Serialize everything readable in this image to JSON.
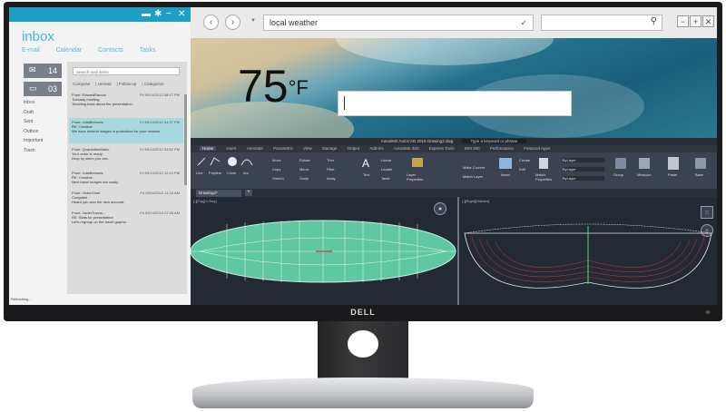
{
  "mail": {
    "title": "inbox",
    "nav": [
      "E-mail",
      "Calendar",
      "Contacts",
      "Tasks"
    ],
    "tiles": [
      {
        "icon": "envelope-icon",
        "count": "14"
      },
      {
        "icon": "chat-icon",
        "count": "03"
      }
    ],
    "folders": [
      "Inbox",
      "Draft",
      "Sent",
      "Outbox",
      "Important",
      "Trash"
    ],
    "search_placeholder": "Search mail items",
    "filters": [
      "Compose",
      "Unread",
      "Follow-up",
      "Categorize"
    ],
    "messages": [
      {
        "from": "From: EdwardRamos",
        "date": "Fri 09/14/2012 08:17 PM",
        "line1": "Tuesday meeting",
        "line2": "Touching base about the presentation.",
        "selected": false
      },
      {
        "from": "From: JuliaBehrans",
        "date": "Fri 09/14/2012 04:37 PM",
        "line1": "RE: Creative",
        "line2": "We have several images in production for your reviews.",
        "selected": true
      },
      {
        "from": "From: QuarantineMario",
        "date": "Fri 09/14/2012 03:52 PM",
        "line1": "Your order is ready.",
        "line2": "Drop by when you can.",
        "selected": false
      },
      {
        "from": "From: JuliaBehrans",
        "date": "Fri 09/14/2012 12:13 PM",
        "line1": "RE: Creative.",
        "line2": "Next travel images are ready.",
        "selected": false
      },
      {
        "from": "From: VictorChen",
        "date": "Fri 09/14/2012 11:16 AM",
        "line1": "Congrats!",
        "line2": "Heard you won the new account.",
        "selected": false
      },
      {
        "from": "From: JavierTruma...",
        "date": "Fri 09/14/2012 07:28 AM",
        "line1": "RE: Stats for presentation",
        "line2": "Let's regroup on the travel graphs.",
        "selected": false
      }
    ],
    "status": "Refreshing..."
  },
  "browser": {
    "address": "local weather",
    "temperature": "75",
    "unit": "°F"
  },
  "cad": {
    "title": "Autodesk AutoCAD 2015   Drawing2.dwg",
    "search_hint": "Type a keyword or phrase",
    "tabs": [
      "Home",
      "Insert",
      "Annotate",
      "Parametric",
      "View",
      "Manage",
      "Output",
      "Add-ins",
      "Autodesk 360",
      "Express Tools",
      "BIM 360",
      "Performance",
      "Featured Apps"
    ],
    "draw_tools": [
      "Line",
      "Polyline",
      "Circle",
      "Arc"
    ],
    "modify_tools": [
      "Move",
      "Rotate",
      "Trim",
      "Copy",
      "Mirror",
      "Fillet",
      "Stretch",
      "Scale",
      "Array"
    ],
    "annotation_tools": [
      "Text",
      "Linear",
      "Leader",
      "Table"
    ],
    "layer_tools": [
      "Layer Properties",
      "Make Current",
      "Match Layer"
    ],
    "block_tools": [
      "Insert",
      "Create",
      "Edit"
    ],
    "property_tools": [
      "Match Properties",
      "ByLayer",
      "ByLayer",
      "ByLayer"
    ],
    "groups": [
      "Draw",
      "Modify",
      "Annotation",
      "Layers",
      "Block",
      "Properties",
      "Groups",
      "Utilities",
      "Clipboard",
      "View"
    ],
    "extra_tools": [
      "Group",
      "Measure",
      "Paste",
      "Base"
    ],
    "document_tab": "Drawing2*",
    "viewport_left": "[-][Top][X-Ray]",
    "viewport_right": "[-][Right][Hidden]"
  },
  "monitor": {
    "brand": "DELL"
  },
  "colors": {
    "mail_accent": "#1f9ec6",
    "cad_hull": "#5fc8a2",
    "cad_bg": "#232a33"
  }
}
